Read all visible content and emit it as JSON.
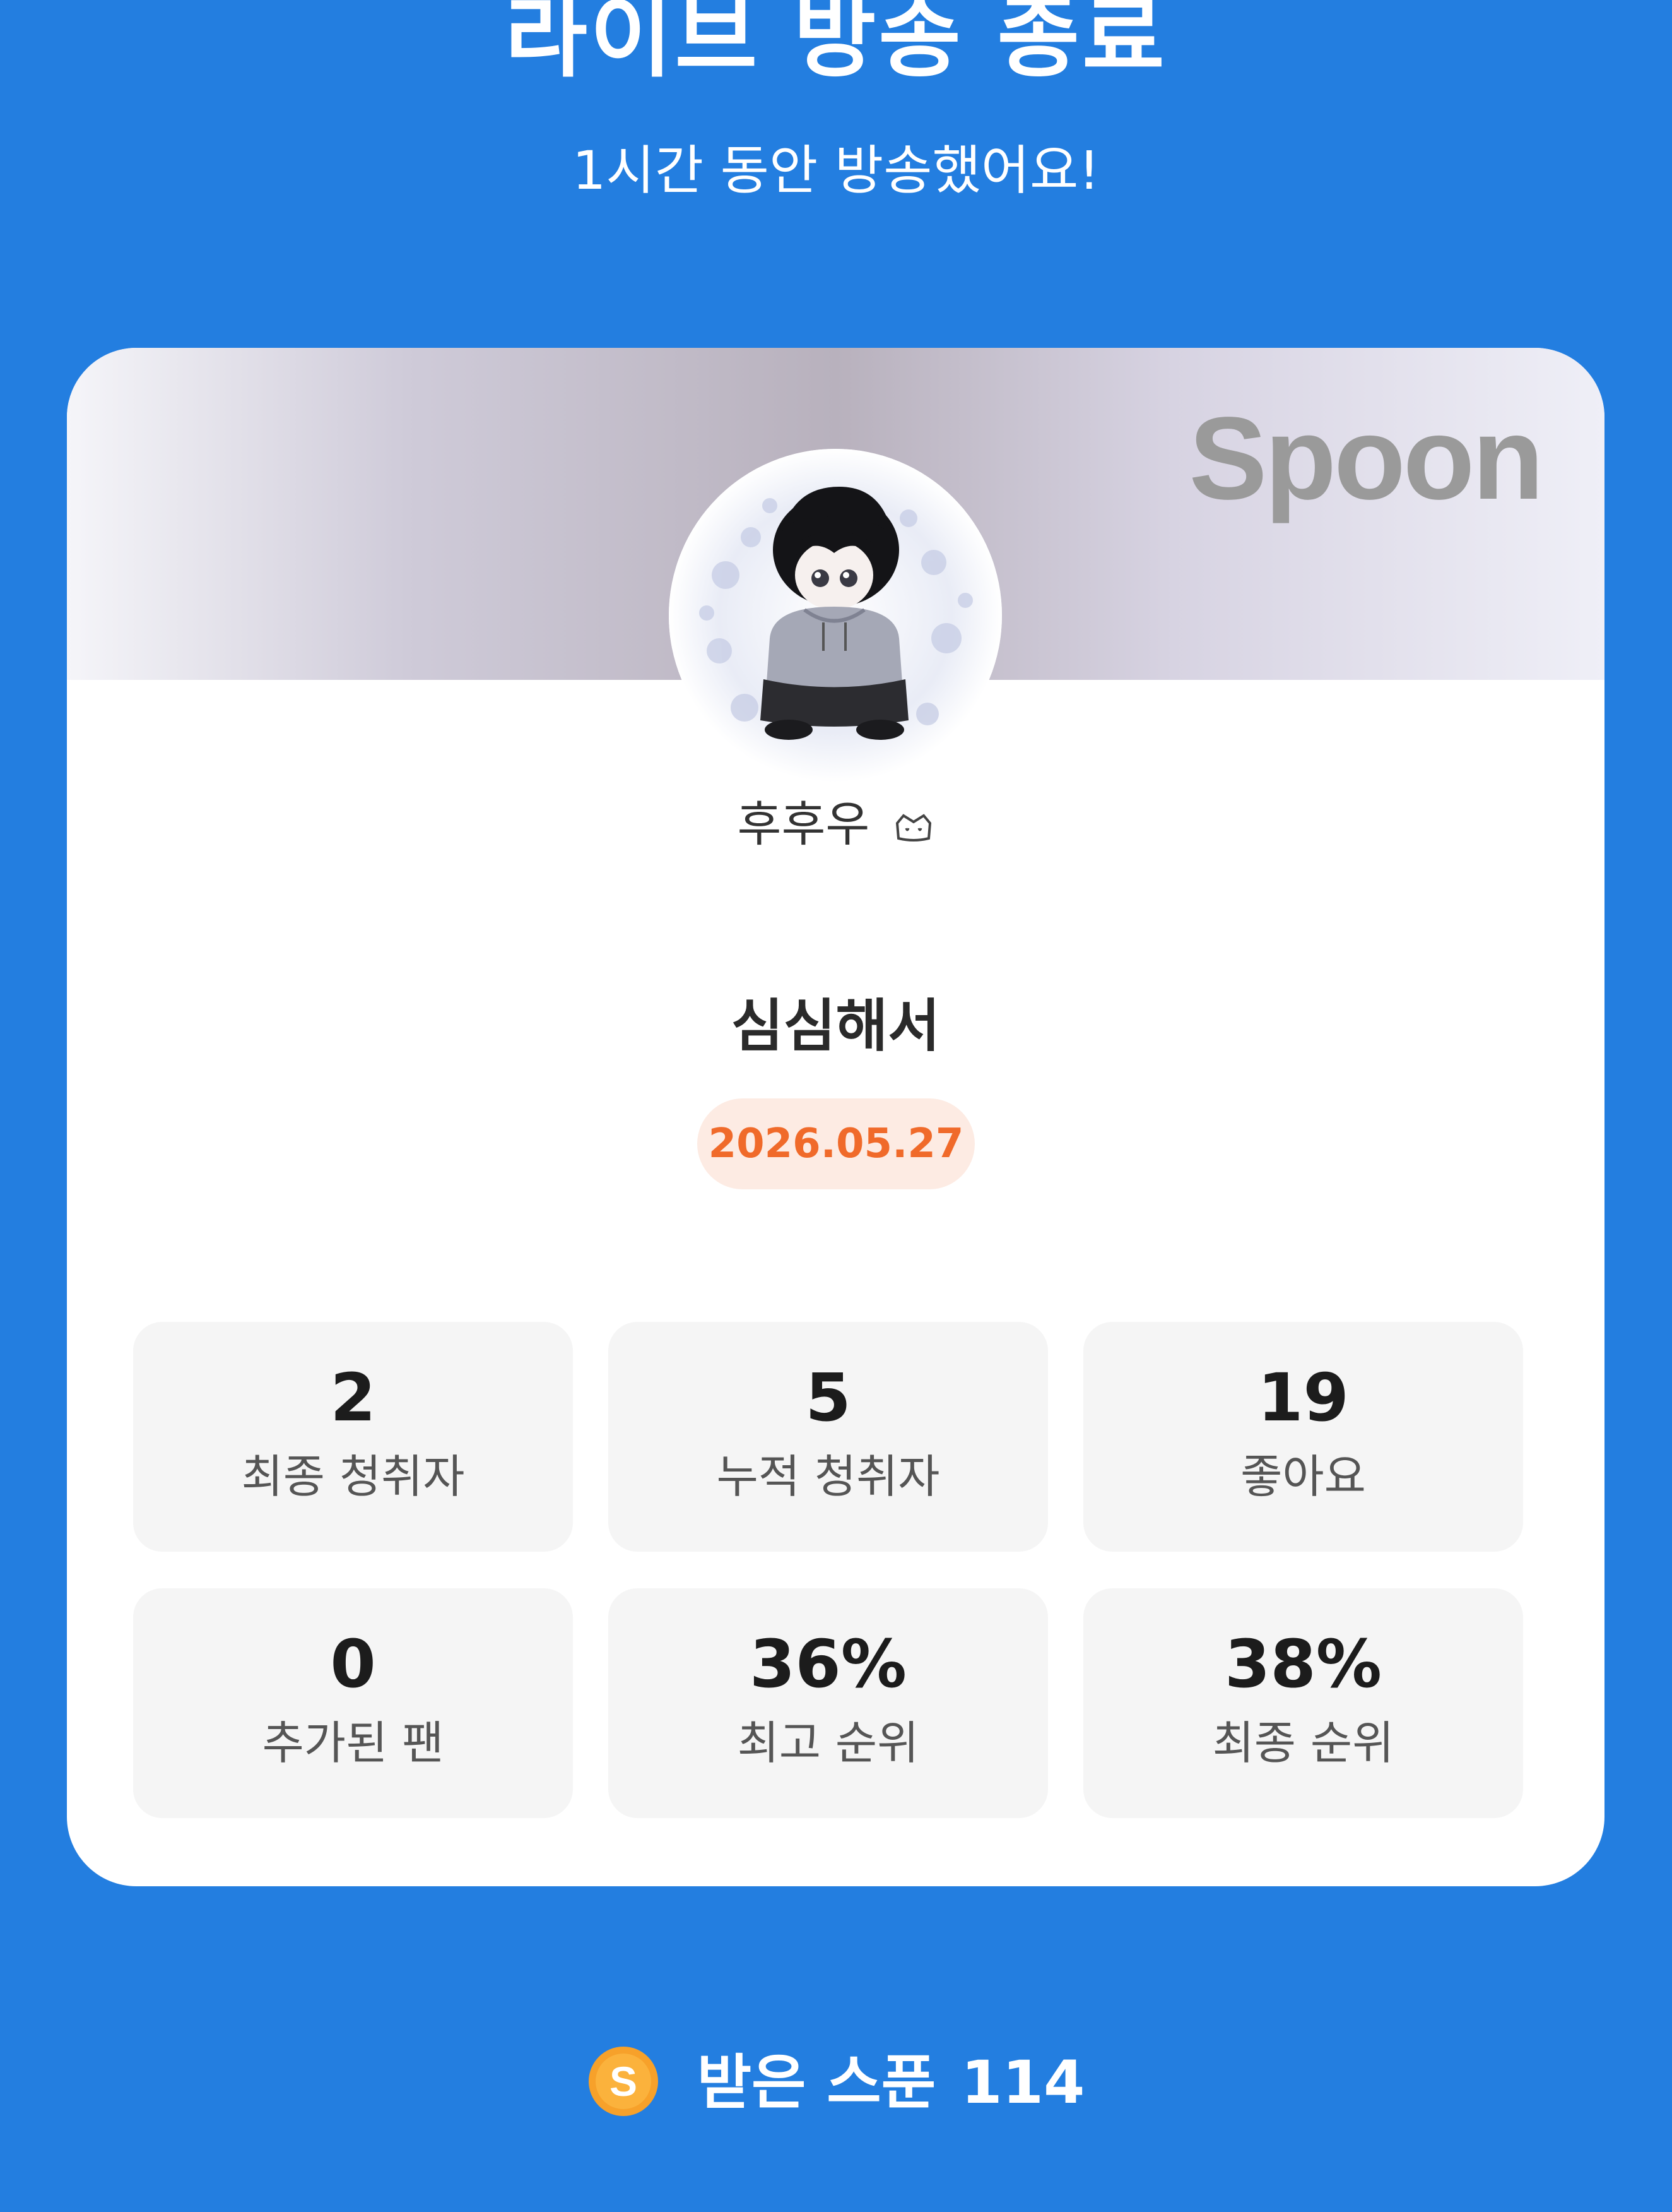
{
  "header": {
    "title": "라이브 방송 종료",
    "subtitle": "1시간 동안 방송했어요!"
  },
  "card": {
    "brand": "Spoon",
    "host_name": "후후우",
    "host_badge_icon": "crown-badge-icon",
    "live_title": "심심해서",
    "date": "2026.05.27",
    "stats": [
      {
        "value": "2",
        "label": "최종 청취자"
      },
      {
        "value": "5",
        "label": "누적 청취자"
      },
      {
        "value": "19",
        "label": "좋아요"
      },
      {
        "value": "0",
        "label": "추가된 팬"
      },
      {
        "value": "36%",
        "label": "최고 순위"
      },
      {
        "value": "38%",
        "label": "최종 순위"
      }
    ]
  },
  "spoons": {
    "label": "받은 스푼",
    "value": "114",
    "icon": "spoon-coin-icon"
  },
  "colors": {
    "background": "#237ee0",
    "date_text": "#f06a2a",
    "date_bg": "#fdebe3",
    "coin": "#f7a12a"
  }
}
